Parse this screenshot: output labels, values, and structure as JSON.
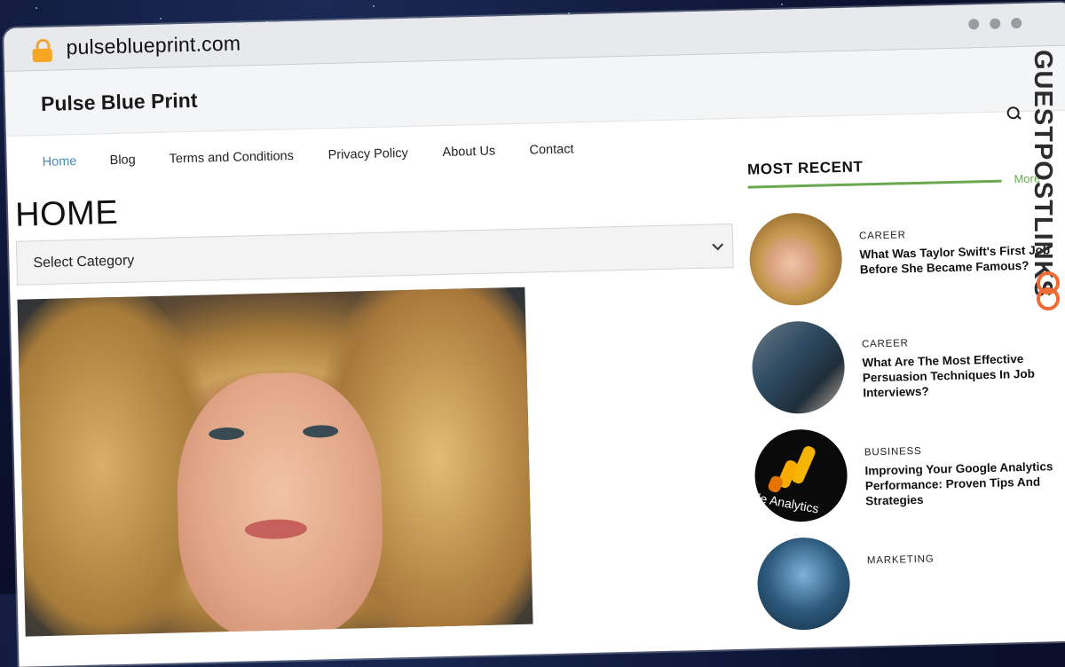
{
  "browser": {
    "url": "pulseblueprint.com"
  },
  "site": {
    "title": "Pulse Blue Print"
  },
  "nav": {
    "items": [
      "Home",
      "Blog",
      "Terms and Conditions",
      "Privacy Policy",
      "About Us",
      "Contact"
    ],
    "active": "Home"
  },
  "main": {
    "page_title": "HOME",
    "category_select": "Select Category"
  },
  "sidebar": {
    "heading": "MOST RECENT",
    "more_label": "More",
    "posts": [
      {
        "category": "CAREER",
        "title": "What Was Taylor Swift's First Job Before She Became Famous?"
      },
      {
        "category": "CAREER",
        "title": "What Are The Most Effective Persuasion Techniques In Job Interviews?"
      },
      {
        "category": "BUSINESS",
        "title": "Improving Your Google Analytics Performance: Proven Tips And Strategies",
        "thumb_text": "gle Analytics"
      },
      {
        "category": "MARKETING",
        "title": ""
      }
    ]
  },
  "watermark": {
    "text": "GUESTPOSTLINKS"
  },
  "colors": {
    "accent_green": "#6aa84f",
    "nav_active": "#4a8bb0",
    "watermark_orange": "#ef6b35"
  }
}
